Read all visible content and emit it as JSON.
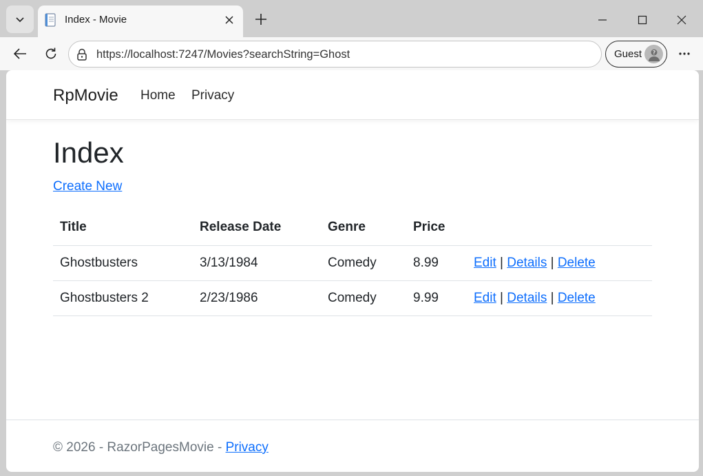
{
  "browser": {
    "tab_title": "Index - Movie",
    "url": "https://localhost:7247/Movies?searchString=Ghost",
    "profile_label": "Guest",
    "icons": {
      "tab_list": "chevron-down-icon",
      "favicon": "page-icon",
      "close": "close-icon",
      "new_tab": "plus-icon",
      "minimize": "minimize-icon",
      "maximize": "maximize-icon",
      "window_close": "close-icon",
      "back": "back-arrow-icon",
      "refresh": "refresh-icon",
      "lock": "lock-icon",
      "avatar": "avatar-icon",
      "more": "more-icon"
    }
  },
  "site": {
    "brand": "RpMovie",
    "nav": [
      {
        "label": "Home"
      },
      {
        "label": "Privacy"
      }
    ]
  },
  "main": {
    "title": "Index",
    "create_new": "Create New",
    "columns": [
      "Title",
      "Release Date",
      "Genre",
      "Price"
    ],
    "rows": [
      {
        "title": "Ghostbusters",
        "release_date": "3/13/1984",
        "genre": "Comedy",
        "price": "8.99"
      },
      {
        "title": "Ghostbusters 2",
        "release_date": "2/23/1986",
        "genre": "Comedy",
        "price": "9.99"
      }
    ],
    "actions": {
      "edit": "Edit",
      "details": "Details",
      "delete": "Delete",
      "separator": "|"
    }
  },
  "footer": {
    "text": "© 2026 - RazorPagesMovie - ",
    "privacy": "Privacy"
  },
  "colors": {
    "link": "#0d6efd",
    "text": "#212529",
    "muted": "#6c757d",
    "chrome": "#cfcfcf"
  }
}
